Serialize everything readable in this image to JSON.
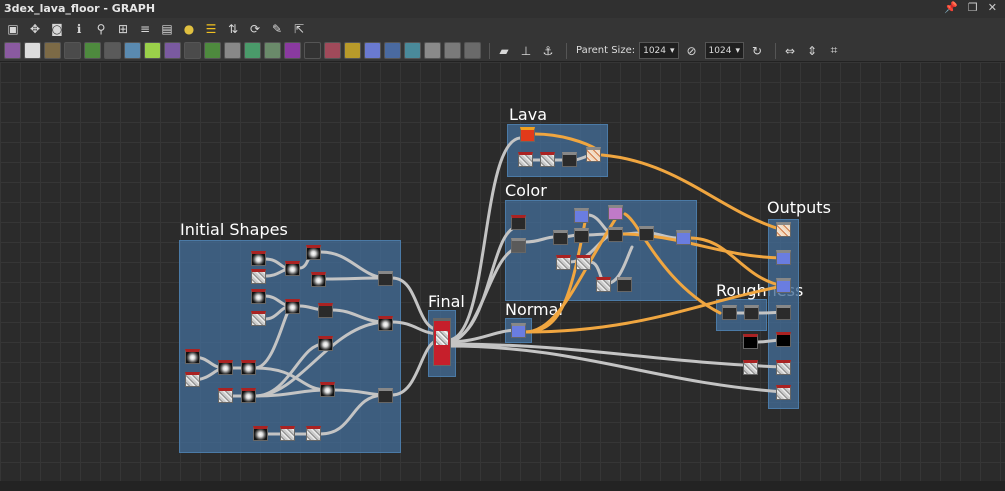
{
  "window": {
    "title": "3dex_lava_floor - GRAPH",
    "controls": [
      "pin-icon",
      "restore-icon",
      "close-icon"
    ]
  },
  "toolbar_top": {
    "icons": [
      "frame-select-icon",
      "center-view-icon",
      "screenshot-icon",
      "info-icon",
      "search-icon",
      "hierarchy-icon",
      "align-icon",
      "list-icon",
      "python-icon",
      "connect-icon",
      "route-icon",
      "refresh-icon",
      "tools-icon",
      "export-icon"
    ]
  },
  "toolbar_nodes": {
    "node_buttons": [
      {
        "name": "bitmap-node-button",
        "color": "#8a5aa0"
      },
      {
        "name": "svg-node-button",
        "color": "#dcdcdc"
      },
      {
        "name": "fill-node-button",
        "color": "#7c6a46"
      },
      {
        "name": "blend-node-button",
        "color": "#4b4b4b"
      },
      {
        "name": "curve-node-button",
        "color": "#4e8a3e"
      },
      {
        "name": "color-node-button",
        "color": "#5a5a5a"
      },
      {
        "name": "transform-node-button",
        "color": "#5a8ab0"
      },
      {
        "name": "gradient-map-node-button",
        "color": "#9ad04a"
      },
      {
        "name": "uniform-node-button",
        "color": "#7a5aa0"
      },
      {
        "name": "grid-node-button",
        "color": "#4b4b4b"
      },
      {
        "name": "fx-map-node-button",
        "color": "#4e8a3e"
      },
      {
        "name": "levels-node-button",
        "color": "#888888"
      },
      {
        "name": "warp-node-button",
        "color": "#4a9a6a"
      },
      {
        "name": "histogram-node-button",
        "color": "#6a8a6a"
      },
      {
        "name": "hsl-node-button",
        "color": "#8a3aa0"
      },
      {
        "name": "pixel-processor-node-button",
        "color": "#333333"
      },
      {
        "name": "emboss-node-button",
        "color": "#a04a5a"
      },
      {
        "name": "sharpen-node-button",
        "color": "#b89a2a"
      },
      {
        "name": "text-node-button",
        "color": "#6a7ad0"
      },
      {
        "name": "frame-node-button",
        "color": "#4a6aa0"
      },
      {
        "name": "tile-node-button",
        "color": "#4a8a9a"
      },
      {
        "name": "input-node-button",
        "color": "#8a8a8a"
      },
      {
        "name": "output-node-button",
        "color": "#7a7a7a"
      },
      {
        "name": "output2-node-button",
        "color": "#6a6a6a"
      }
    ],
    "extra_icons": [
      "comment-icon",
      "pin-node-icon",
      "anchor-icon"
    ],
    "parent_size_label": "Parent Size:",
    "width_value": "1024",
    "height_value": "1024",
    "link_icon": "link-icon",
    "reset_icon": "reset-icon",
    "right_icons": [
      "fit-horizontal-icon",
      "fit-vertical-icon",
      "snap-icon"
    ]
  },
  "graph": {
    "frames": [
      {
        "id": "initial",
        "title": "Initial Shapes"
      },
      {
        "id": "final",
        "title": "Final"
      },
      {
        "id": "lava",
        "title": "Lava"
      },
      {
        "id": "color",
        "title": "Color"
      },
      {
        "id": "normal",
        "title": "Normal"
      },
      {
        "id": "roughness",
        "title": "Roughness"
      },
      {
        "id": "outputs",
        "title": "Outputs"
      }
    ]
  }
}
